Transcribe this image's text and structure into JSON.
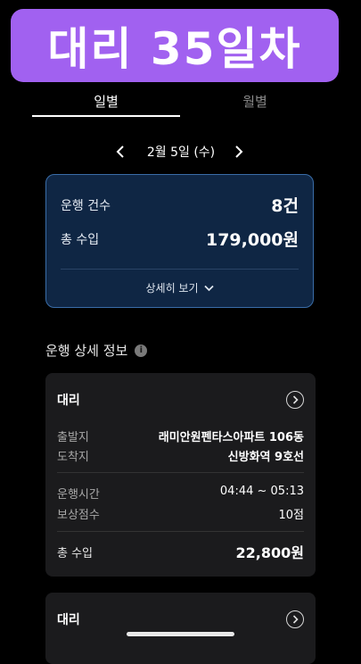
{
  "banner": {
    "text": "대리 35일차"
  },
  "tabs": [
    {
      "label": "일별"
    },
    {
      "label": "월별"
    }
  ],
  "date_nav": {
    "label": "2월 5일 (수)"
  },
  "summary": {
    "trips_label": "운행 건수",
    "trips_value": "8건",
    "income_label": "총 수입",
    "income_value": "179,000원",
    "detail_label": "상세히 보기"
  },
  "section": {
    "title": "운행 상세 정보"
  },
  "cards": [
    {
      "title": "대리",
      "from_label": "출발지",
      "from_value": "래미안원펜타스아파트 106동",
      "to_label": "도착지",
      "to_value": "신방화역 9호선",
      "time_label": "운행시간",
      "time_value": "04:44 ~ 05:13",
      "points_label": "보상점수",
      "points_value": "10점",
      "total_label": "총 수입",
      "total_value": "22,800원"
    },
    {
      "title": "대리"
    }
  ],
  "colors": {
    "banner": "#a161f0",
    "summary_bg": "#0f2644",
    "summary_border": "#3a6da8",
    "card_bg": "#1b1b1d"
  }
}
